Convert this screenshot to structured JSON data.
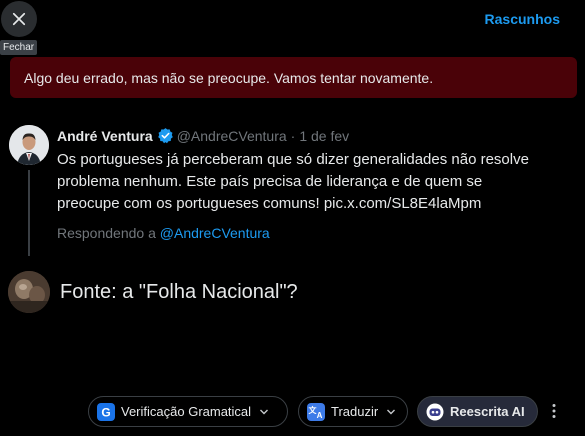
{
  "header": {
    "close_tooltip": "Fechar",
    "drafts_label": "Rascunhos"
  },
  "error": {
    "message": "Algo deu errado, mas não se preocupe. Vamos tentar novamente."
  },
  "quoted_tweet": {
    "author_name": "André Ventura",
    "handle": "@AndreCVentura",
    "separator": "·",
    "date": "1 de fev",
    "text": "Os portugueses já perceberam que só dizer generalidades não resolve problema nenhum. Este país precisa de liderança e de quem se preocupe com os portugueses comuns! pic.x.com/SL8E4laMpm",
    "replying_prefix": "Respondendo a",
    "replying_mention": "@AndreCVentura"
  },
  "composer": {
    "text": "Fonte: a \"Folha Nacional\"?"
  },
  "toolbar": {
    "grammar_label": "Verificação Gramatical",
    "translate_label": "Traduzir",
    "rewrite_label": "Reescrita AI"
  },
  "colors": {
    "accent": "#1d9bf0",
    "error_bg": "#4a0208",
    "muted": "#71767b"
  }
}
